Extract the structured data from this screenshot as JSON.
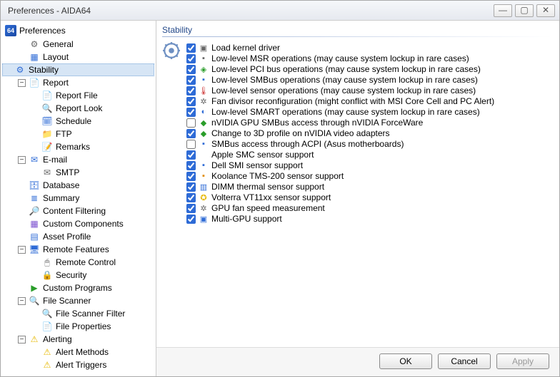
{
  "window": {
    "title": "Preferences - AIDA64"
  },
  "tree": {
    "root": "Preferences",
    "items": [
      {
        "label": "General",
        "indent": 1
      },
      {
        "label": "Layout",
        "indent": 1
      },
      {
        "label": "Stability",
        "indent": 1,
        "selected": true
      },
      {
        "label": "Report",
        "indent": 1,
        "expandable": true,
        "expanded": true
      },
      {
        "label": "Report File",
        "indent": 2
      },
      {
        "label": "Report Look",
        "indent": 2
      },
      {
        "label": "Schedule",
        "indent": 2
      },
      {
        "label": "FTP",
        "indent": 2
      },
      {
        "label": "Remarks",
        "indent": 2
      },
      {
        "label": "E-mail",
        "indent": 1,
        "expandable": true,
        "expanded": true
      },
      {
        "label": "SMTP",
        "indent": 2
      },
      {
        "label": "Database",
        "indent": 1
      },
      {
        "label": "Summary",
        "indent": 1
      },
      {
        "label": "Content Filtering",
        "indent": 1
      },
      {
        "label": "Custom Components",
        "indent": 1
      },
      {
        "label": "Asset Profile",
        "indent": 1
      },
      {
        "label": "Remote Features",
        "indent": 1,
        "expandable": true,
        "expanded": true
      },
      {
        "label": "Remote Control",
        "indent": 2
      },
      {
        "label": "Security",
        "indent": 2
      },
      {
        "label": "Custom Programs",
        "indent": 1
      },
      {
        "label": "File Scanner",
        "indent": 1,
        "expandable": true,
        "expanded": true
      },
      {
        "label": "File Scanner Filter",
        "indent": 2
      },
      {
        "label": "File Properties",
        "indent": 2
      },
      {
        "label": "Alerting",
        "indent": 1,
        "expandable": true,
        "expanded": true
      },
      {
        "label": "Alert Methods",
        "indent": 2
      },
      {
        "label": "Alert Triggers",
        "indent": 2
      }
    ]
  },
  "panel": {
    "title": "Stability",
    "options": [
      {
        "checked": true,
        "label": "Load kernel driver"
      },
      {
        "checked": true,
        "label": "Low-level MSR operations (may cause system lockup in rare cases)"
      },
      {
        "checked": true,
        "label": "Low-level PCI bus operations (may cause system lockup in rare cases)"
      },
      {
        "checked": true,
        "label": "Low-level SMBus operations (may cause system lockup in rare cases)"
      },
      {
        "checked": true,
        "label": "Low-level sensor operations (may cause system lockup in rare cases)"
      },
      {
        "checked": true,
        "label": "Fan divisor reconfiguration (might conflict with MSI Core Cell and PC Alert)"
      },
      {
        "checked": true,
        "label": "Low-level SMART operations (may cause system lockup in rare cases)"
      },
      {
        "checked": false,
        "label": "nVIDIA GPU SMBus access through nVIDIA ForceWare"
      },
      {
        "checked": true,
        "label": "Change to 3D profile on nVIDIA video adapters"
      },
      {
        "checked": false,
        "label": "SMBus access through ACPI (Asus motherboards)"
      },
      {
        "checked": true,
        "label": "Apple SMC sensor support"
      },
      {
        "checked": true,
        "label": "Dell SMI sensor support"
      },
      {
        "checked": true,
        "label": "Koolance TMS-200 sensor support"
      },
      {
        "checked": true,
        "label": "DIMM thermal sensor support"
      },
      {
        "checked": true,
        "label": "Volterra VT11xx sensor support"
      },
      {
        "checked": true,
        "label": "GPU fan speed measurement"
      },
      {
        "checked": true,
        "label": "Multi-GPU support"
      }
    ]
  },
  "buttons": {
    "ok": "OK",
    "cancel": "Cancel",
    "apply": "Apply"
  }
}
